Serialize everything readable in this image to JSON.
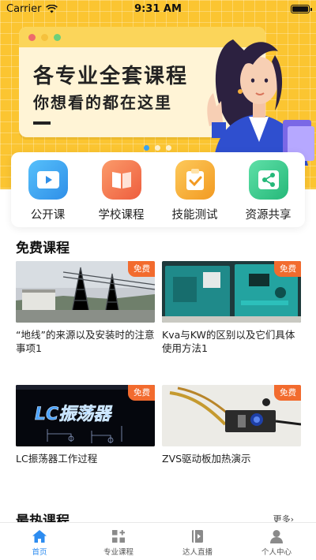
{
  "status_bar": {
    "carrier": "Carrier",
    "time": "9:31 AM"
  },
  "banner": {
    "title": "各专业全套课程",
    "subtitle": "你想看的都在这里",
    "dots": 3,
    "active_dot": 0
  },
  "categories": [
    {
      "label": "公开课",
      "icon": "play-icon",
      "color": "#3aa3f0"
    },
    {
      "label": "学校课程",
      "icon": "book-icon",
      "color": "#f37a4f"
    },
    {
      "label": "技能测试",
      "icon": "checklist-icon",
      "color": "#f6b03a"
    },
    {
      "label": "资源共享",
      "icon": "share-icon",
      "color": "#3fcf94"
    }
  ],
  "free_section": {
    "title": "免费课程",
    "badge": "免费",
    "courses": [
      {
        "title": "“地线”的来源以及安装时的注意事项1"
      },
      {
        "title": "Kva与KW的区别以及它们具体使用方法1"
      },
      {
        "title": "LC振荡器工作过程",
        "thumb_text": "LC振荡器"
      },
      {
        "title": "ZVS驱动板加热演示"
      }
    ]
  },
  "hot_section": {
    "title": "最热课程",
    "more": "更多"
  },
  "tabbar": {
    "active": 0,
    "tabs": [
      {
        "label": "首页",
        "icon": "home-icon"
      },
      {
        "label": "专业课程",
        "icon": "grid-plus-icon"
      },
      {
        "label": "达人直播",
        "icon": "live-book-icon"
      },
      {
        "label": "个人中心",
        "icon": "person-icon"
      }
    ]
  }
}
